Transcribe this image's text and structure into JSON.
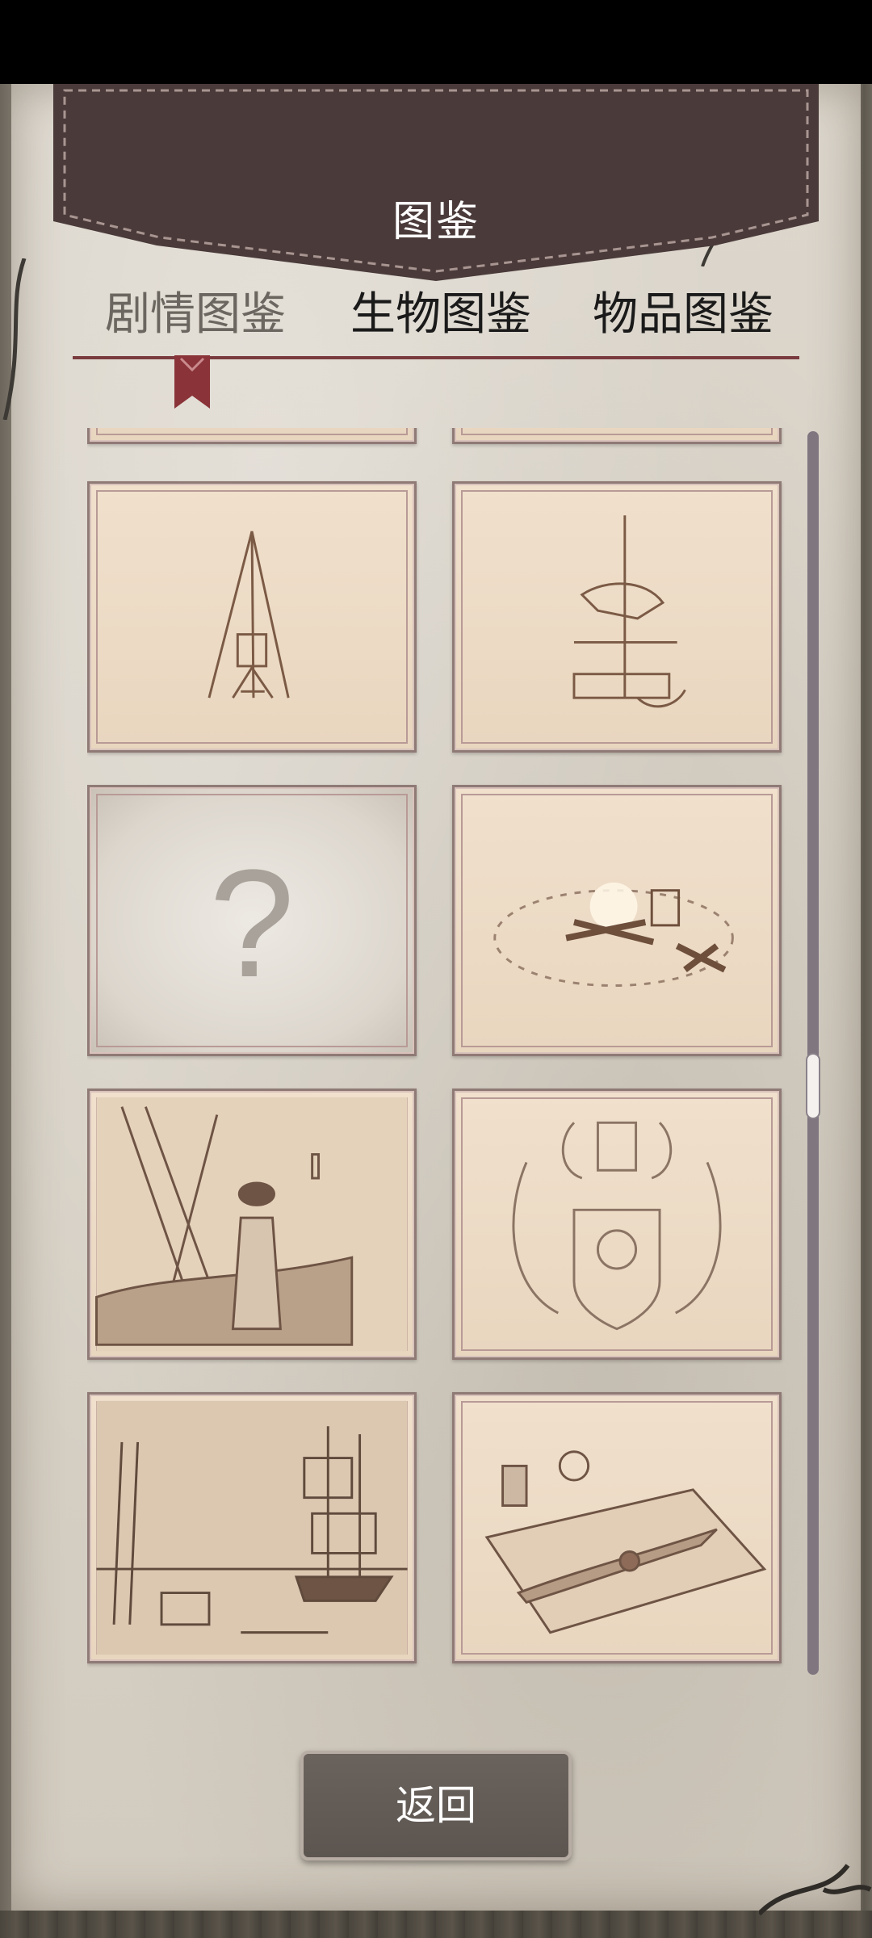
{
  "header": {
    "title": "图鉴"
  },
  "tabs": [
    {
      "label": "剧情图鉴",
      "active": true
    },
    {
      "label": "生物图鉴",
      "active": false
    },
    {
      "label": "物品图鉴",
      "active": false
    }
  ],
  "gallery": {
    "cards": [
      {
        "icon": "tripod-campfire-sketch",
        "unlocked": true
      },
      {
        "icon": "pole-trap-sketch",
        "unlocked": true
      },
      {
        "icon": "question-mark-icon",
        "unlocked": false,
        "symbol": "?"
      },
      {
        "icon": "campfire-circle-sketch",
        "unlocked": true
      },
      {
        "icon": "woman-on-ship-sketch",
        "unlocked": true
      },
      {
        "icon": "dragon-crest-sketch",
        "unlocked": true
      },
      {
        "icon": "harbor-ship-sketch",
        "unlocked": true
      },
      {
        "icon": "letter-and-inkwell-sketch",
        "unlocked": true
      }
    ]
  },
  "footer": {
    "back_label": "返回"
  },
  "colors": {
    "accent": "#7a3b3e",
    "paper": "#dcd6cc",
    "card_border": "#8f7a76",
    "button_bg": "#5c5550"
  }
}
